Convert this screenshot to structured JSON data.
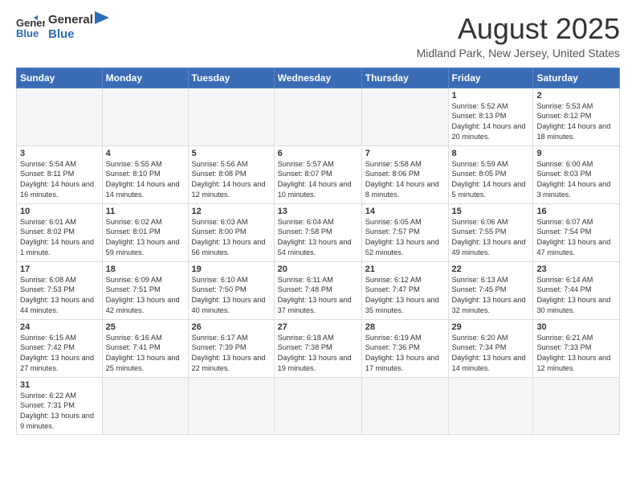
{
  "header": {
    "logo_general": "General",
    "logo_blue": "Blue",
    "month_title": "August 2025",
    "location": "Midland Park, New Jersey, United States"
  },
  "days_of_week": [
    "Sunday",
    "Monday",
    "Tuesday",
    "Wednesday",
    "Thursday",
    "Friday",
    "Saturday"
  ],
  "weeks": [
    [
      {
        "day": "",
        "info": ""
      },
      {
        "day": "",
        "info": ""
      },
      {
        "day": "",
        "info": ""
      },
      {
        "day": "",
        "info": ""
      },
      {
        "day": "",
        "info": ""
      },
      {
        "day": "1",
        "info": "Sunrise: 5:52 AM\nSunset: 8:13 PM\nDaylight: 14 hours and 20 minutes."
      },
      {
        "day": "2",
        "info": "Sunrise: 5:53 AM\nSunset: 8:12 PM\nDaylight: 14 hours and 18 minutes."
      }
    ],
    [
      {
        "day": "3",
        "info": "Sunrise: 5:54 AM\nSunset: 8:11 PM\nDaylight: 14 hours and 16 minutes."
      },
      {
        "day": "4",
        "info": "Sunrise: 5:55 AM\nSunset: 8:10 PM\nDaylight: 14 hours and 14 minutes."
      },
      {
        "day": "5",
        "info": "Sunrise: 5:56 AM\nSunset: 8:08 PM\nDaylight: 14 hours and 12 minutes."
      },
      {
        "day": "6",
        "info": "Sunrise: 5:57 AM\nSunset: 8:07 PM\nDaylight: 14 hours and 10 minutes."
      },
      {
        "day": "7",
        "info": "Sunrise: 5:58 AM\nSunset: 8:06 PM\nDaylight: 14 hours and 8 minutes."
      },
      {
        "day": "8",
        "info": "Sunrise: 5:59 AM\nSunset: 8:05 PM\nDaylight: 14 hours and 5 minutes."
      },
      {
        "day": "9",
        "info": "Sunrise: 6:00 AM\nSunset: 8:03 PM\nDaylight: 14 hours and 3 minutes."
      }
    ],
    [
      {
        "day": "10",
        "info": "Sunrise: 6:01 AM\nSunset: 8:02 PM\nDaylight: 14 hours and 1 minute."
      },
      {
        "day": "11",
        "info": "Sunrise: 6:02 AM\nSunset: 8:01 PM\nDaylight: 13 hours and 59 minutes."
      },
      {
        "day": "12",
        "info": "Sunrise: 6:03 AM\nSunset: 8:00 PM\nDaylight: 13 hours and 56 minutes."
      },
      {
        "day": "13",
        "info": "Sunrise: 6:04 AM\nSunset: 7:58 PM\nDaylight: 13 hours and 54 minutes."
      },
      {
        "day": "14",
        "info": "Sunrise: 6:05 AM\nSunset: 7:57 PM\nDaylight: 13 hours and 52 minutes."
      },
      {
        "day": "15",
        "info": "Sunrise: 6:06 AM\nSunset: 7:55 PM\nDaylight: 13 hours and 49 minutes."
      },
      {
        "day": "16",
        "info": "Sunrise: 6:07 AM\nSunset: 7:54 PM\nDaylight: 13 hours and 47 minutes."
      }
    ],
    [
      {
        "day": "17",
        "info": "Sunrise: 6:08 AM\nSunset: 7:53 PM\nDaylight: 13 hours and 44 minutes."
      },
      {
        "day": "18",
        "info": "Sunrise: 6:09 AM\nSunset: 7:51 PM\nDaylight: 13 hours and 42 minutes."
      },
      {
        "day": "19",
        "info": "Sunrise: 6:10 AM\nSunset: 7:50 PM\nDaylight: 13 hours and 40 minutes."
      },
      {
        "day": "20",
        "info": "Sunrise: 6:11 AM\nSunset: 7:48 PM\nDaylight: 13 hours and 37 minutes."
      },
      {
        "day": "21",
        "info": "Sunrise: 6:12 AM\nSunset: 7:47 PM\nDaylight: 13 hours and 35 minutes."
      },
      {
        "day": "22",
        "info": "Sunrise: 6:13 AM\nSunset: 7:45 PM\nDaylight: 13 hours and 32 minutes."
      },
      {
        "day": "23",
        "info": "Sunrise: 6:14 AM\nSunset: 7:44 PM\nDaylight: 13 hours and 30 minutes."
      }
    ],
    [
      {
        "day": "24",
        "info": "Sunrise: 6:15 AM\nSunset: 7:42 PM\nDaylight: 13 hours and 27 minutes."
      },
      {
        "day": "25",
        "info": "Sunrise: 6:16 AM\nSunset: 7:41 PM\nDaylight: 13 hours and 25 minutes."
      },
      {
        "day": "26",
        "info": "Sunrise: 6:17 AM\nSunset: 7:39 PM\nDaylight: 13 hours and 22 minutes."
      },
      {
        "day": "27",
        "info": "Sunrise: 6:18 AM\nSunset: 7:38 PM\nDaylight: 13 hours and 19 minutes."
      },
      {
        "day": "28",
        "info": "Sunrise: 6:19 AM\nSunset: 7:36 PM\nDaylight: 13 hours and 17 minutes."
      },
      {
        "day": "29",
        "info": "Sunrise: 6:20 AM\nSunset: 7:34 PM\nDaylight: 13 hours and 14 minutes."
      },
      {
        "day": "30",
        "info": "Sunrise: 6:21 AM\nSunset: 7:33 PM\nDaylight: 13 hours and 12 minutes."
      }
    ],
    [
      {
        "day": "31",
        "info": "Sunrise: 6:22 AM\nSunset: 7:31 PM\nDaylight: 13 hours and 9 minutes."
      },
      {
        "day": "",
        "info": ""
      },
      {
        "day": "",
        "info": ""
      },
      {
        "day": "",
        "info": ""
      },
      {
        "day": "",
        "info": ""
      },
      {
        "day": "",
        "info": ""
      },
      {
        "day": "",
        "info": ""
      }
    ]
  ]
}
